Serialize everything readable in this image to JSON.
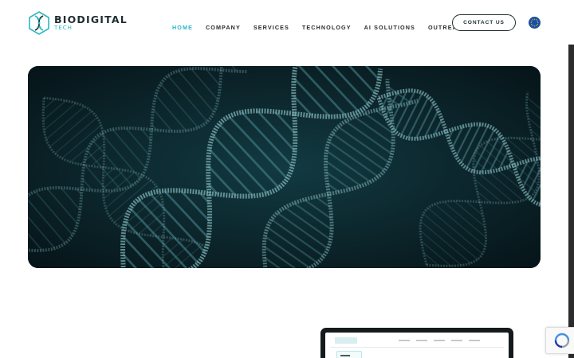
{
  "brand": {
    "name": "BIODIGITAL",
    "sub": "TECH",
    "accent": "#2bb7c2",
    "dark": "#1f2d2f"
  },
  "nav": {
    "items": [
      {
        "label": "HOME",
        "active": true
      },
      {
        "label": "COMPANY",
        "active": false
      },
      {
        "label": "SERVICES",
        "active": false
      },
      {
        "label": "TECHNOLOGY",
        "active": false
      },
      {
        "label": "AI SOLUTIONS",
        "active": false
      },
      {
        "label": "OUTREACH",
        "active": false
      }
    ],
    "contact_label": "CONTACT US",
    "language_icon": "eu-flag-icon"
  },
  "hero": {
    "image": "dna-helix-image",
    "background": "#0a1d22"
  },
  "preview": {
    "image": "laptop-dashboard-preview"
  },
  "widgets": {
    "recaptcha_icon": "recaptcha-icon"
  }
}
